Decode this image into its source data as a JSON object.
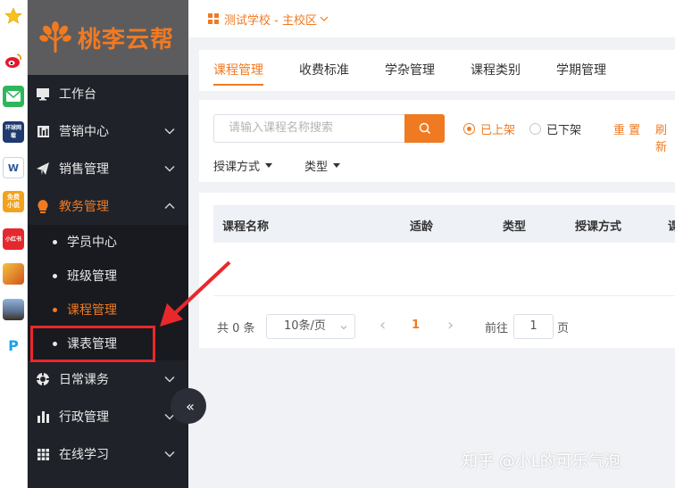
{
  "bookmarks": [
    {
      "icon": "star-icon",
      "color": "#f7c21b",
      "label": ""
    },
    {
      "icon": "weibo-icon",
      "color": "#e6162d",
      "label": ""
    },
    {
      "icon": "mail-icon",
      "color": "#2fb65b",
      "label": ""
    },
    {
      "icon": "globe-news-icon",
      "color": "#1e3a6e",
      "label": "环球网载"
    },
    {
      "icon": "word-doc-icon",
      "color": "#2b5797",
      "label": "W"
    },
    {
      "icon": "novel-icon",
      "color": "#f2a21d",
      "label": "免费小说"
    },
    {
      "icon": "xiaohongshu-icon",
      "color": "#e6282e",
      "label": "小红书"
    },
    {
      "icon": "game-icon",
      "color": "#d0541a",
      "label": ""
    },
    {
      "icon": "game2-icon",
      "color": "#5b6e8c",
      "label": ""
    },
    {
      "icon": "p-app-icon",
      "color": "#1aa3e8",
      "label": "P"
    }
  ],
  "brand": {
    "name": "桃李云帮",
    "color": "#f07a22"
  },
  "sidebar": {
    "items": [
      {
        "label": "工作台",
        "icon": "monitor-icon",
        "has_chevron": false
      },
      {
        "label": "营销中心",
        "icon": "chart-book-icon",
        "has_chevron": true
      },
      {
        "label": "销售管理",
        "icon": "paper-plane-icon",
        "has_chevron": true
      },
      {
        "label": "教务管理",
        "icon": "lightbulb-icon",
        "has_chevron": true,
        "expanded": true
      }
    ],
    "submenu": [
      {
        "label": "学员中心"
      },
      {
        "label": "班级管理"
      },
      {
        "label": "课程管理",
        "current": true
      },
      {
        "label": "课表管理"
      }
    ],
    "items_after": [
      {
        "label": "日常课务",
        "icon": "lifebuoy-icon"
      },
      {
        "label": "行政管理",
        "icon": "bar-chart-icon"
      },
      {
        "label": "在线学习",
        "icon": "grid-icon"
      }
    ],
    "collapse_glyph": "«"
  },
  "topbar": {
    "school": "测试学校 - 主校区"
  },
  "tabs": [
    {
      "label": "课程管理",
      "active": true
    },
    {
      "label": "收费标准"
    },
    {
      "label": "学杂管理"
    },
    {
      "label": "课程类别"
    },
    {
      "label": "学期管理"
    }
  ],
  "filter": {
    "search_placeholder": "请输入课程名称搜索",
    "radio_on": "已上架",
    "radio_off": "已下架",
    "reset": "重 置",
    "refresh": "刷 新",
    "dropdown_1": "授课方式",
    "dropdown_2": "类型"
  },
  "table": {
    "columns": [
      "课程名称",
      "适龄",
      "类型",
      "授课方式",
      "课"
    ]
  },
  "pager": {
    "total": "共 0 条",
    "page_size": "10条/页",
    "prev": "‹",
    "current_page": "1",
    "next": "›",
    "goto_label": "前往",
    "goto_value": "1",
    "page_suffix": "页"
  },
  "watermark": "知乎 @小L的可乐气泡",
  "colors": {
    "accent": "#f07a22",
    "highlight": "#e8282b",
    "sidebar_bg": "#1f2229"
  }
}
